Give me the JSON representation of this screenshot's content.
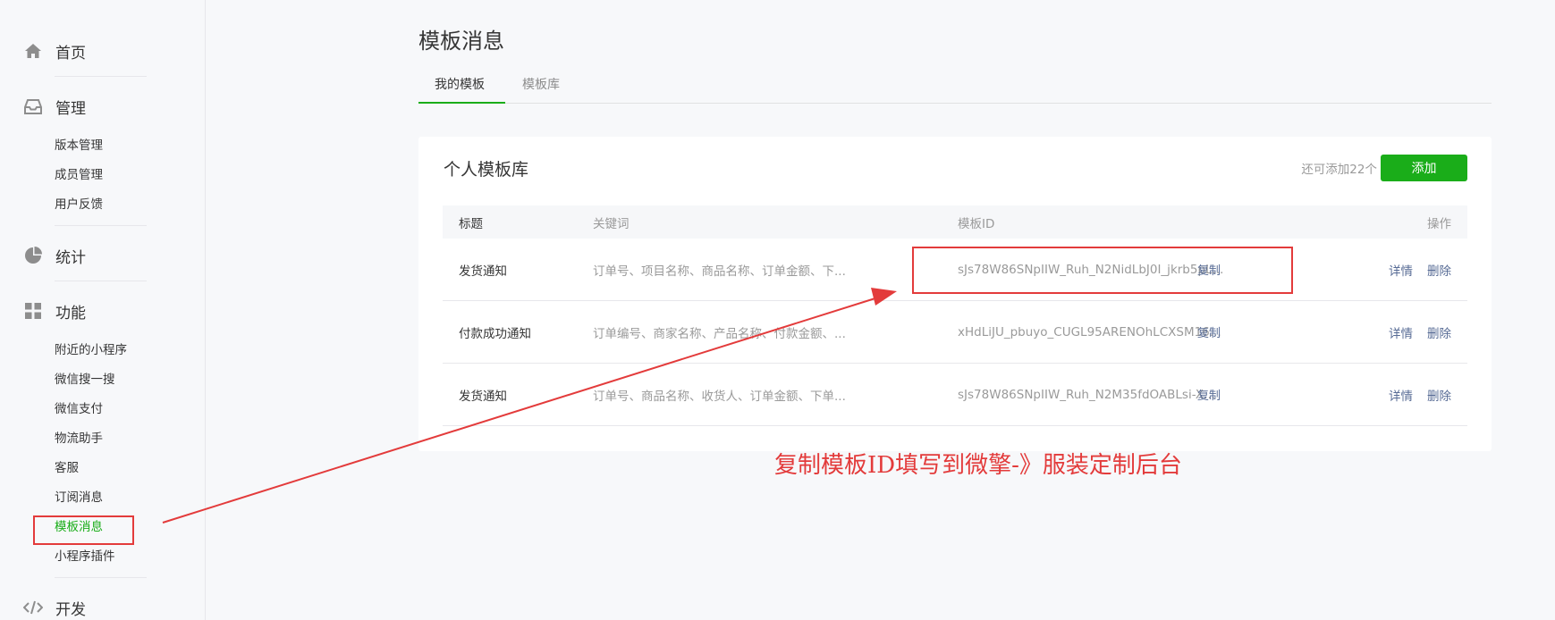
{
  "sidebar": {
    "home": {
      "label": "首页",
      "icon": "home-icon"
    },
    "manage": {
      "label": "管理",
      "icon": "inbox-icon",
      "items": [
        {
          "label": "版本管理"
        },
        {
          "label": "成员管理"
        },
        {
          "label": "用户反馈"
        }
      ]
    },
    "stats": {
      "label": "统计",
      "icon": "pie-chart-icon"
    },
    "features": {
      "label": "功能",
      "icon": "grid-icon",
      "items": [
        {
          "label": "附近的小程序"
        },
        {
          "label": "微信搜一搜"
        },
        {
          "label": "微信支付"
        },
        {
          "label": "物流助手"
        },
        {
          "label": "客服"
        },
        {
          "label": "订阅消息"
        },
        {
          "label": "模板消息",
          "active": true
        },
        {
          "label": "小程序插件"
        }
      ]
    },
    "dev": {
      "label": "开发",
      "icon": "code-icon"
    }
  },
  "main": {
    "title": "模板消息",
    "tabs": [
      {
        "label": "我的模板",
        "active": true
      },
      {
        "label": "模板库",
        "active": false
      }
    ],
    "card": {
      "title": "个人模板库",
      "remain": "还可添加22个",
      "add_label": "添加",
      "columns": {
        "title": "标题",
        "keywords": "关键词",
        "template_id": "模板ID",
        "actions": "操作"
      },
      "rows": [
        {
          "title": "发货通知",
          "keywords": "订单号、项目名称、商品名称、订单金额、下...",
          "template_id": "sJs78W86SNpIIW_Ruh_N2NidLbJ0I_jkrb5pL...",
          "copy": "复制",
          "detail": "详情",
          "delete": "删除"
        },
        {
          "title": "付款成功通知",
          "keywords": "订单编号、商家名称、产品名称、付款金额、...",
          "template_id": "xHdLiJU_pbuyo_CUGL95ARENOhLCXSM16...",
          "copy": "复制",
          "detail": "详情",
          "delete": "删除"
        },
        {
          "title": "发货通知",
          "keywords": "订单号、商品名称、收货人、订单金额、下单...",
          "template_id": "sJs78W86SNpIIW_Ruh_N2M35fdOABLsi-X...",
          "copy": "复制",
          "detail": "详情",
          "delete": "删除"
        }
      ]
    }
  },
  "annotation": {
    "text": "复制模板ID填写到微擎-》服装定制后台",
    "color": "#e33b3b"
  },
  "colors": {
    "accent": "#1aad19",
    "link": "#576b95",
    "annotation": "#e33b3b"
  }
}
